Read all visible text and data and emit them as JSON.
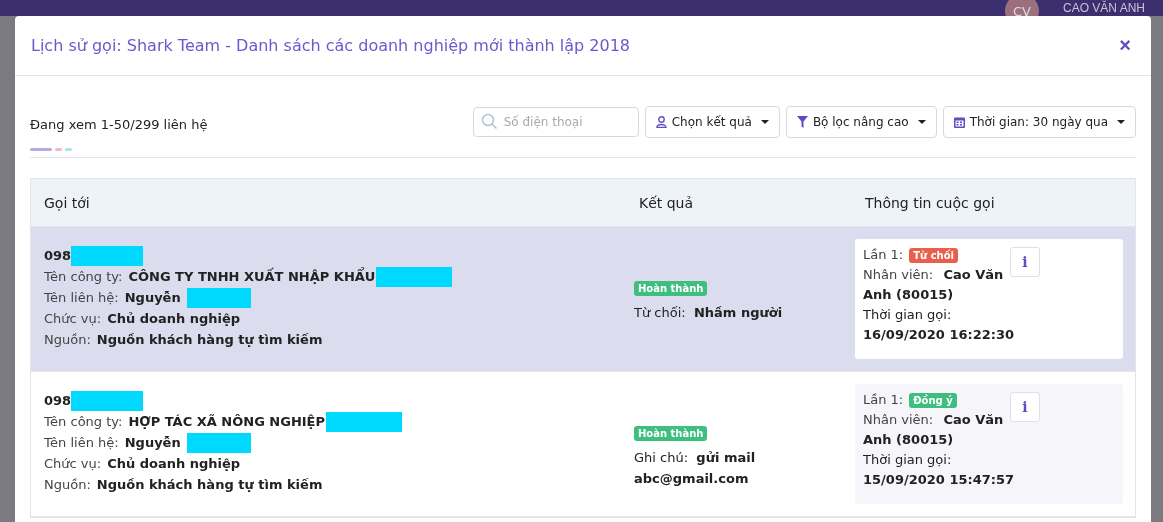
{
  "app_bar": {
    "avatar_initials": "CV",
    "user_name": "CAO VĂN ANH"
  },
  "dialog": {
    "title": "Lịch sử gọi: Shark Team - Danh sách các doanh nghiệp mới thành lập 2018",
    "close": "×"
  },
  "summary": "Đang xem 1-50/299 liên hệ",
  "search": {
    "placeholder": "Số điện thoại"
  },
  "filters": [
    {
      "label": "Chọn kết quả",
      "kind": "user"
    },
    {
      "label": "Bộ lọc nâng cao",
      "kind": "filter"
    },
    {
      "label": "Thời gian: 30 ngày qua",
      "kind": "calendar"
    }
  ],
  "table": {
    "columns": [
      "Gọi tới",
      "Kết quả",
      "Thông tin cuộc gọi"
    ],
    "rows": [
      {
        "selected": true,
        "phone": "098",
        "fields": [
          {
            "label": "Tên công ty:",
            "value": "CÔNG TY TNHH XUẤT NHẬP KHẨU"
          },
          {
            "label": "Tên liên hệ:",
            "value": "Nguyễn"
          },
          {
            "label": "Chức vụ:",
            "value": "Chủ doanh nghiệp"
          },
          {
            "label": "Nguồn:",
            "value": "Nguồn khách hàng tự tìm kiếm"
          }
        ],
        "status": "Hoàn thành",
        "result_label": "Từ chối:",
        "result_value": "Nhầm người",
        "attempt": "Lần 1:",
        "outcome": {
          "label": "Từ chối",
          "color": "#e8604c"
        },
        "staff_label": "Nhân viên:",
        "staff": "Cao Văn Anh (80015)",
        "time_label": "Thời gian gọi:",
        "time": "16/09/2020 16:22:30",
        "info": "i"
      },
      {
        "selected": false,
        "phone": "098",
        "fields": [
          {
            "label": "Tên công ty:",
            "value": "HỢP TÁC XÃ NÔNG NGHIỆP"
          },
          {
            "label": "Tên liên hệ:",
            "value": "Nguyễn"
          },
          {
            "label": "Chức vụ:",
            "value": "Chủ doanh nghiệp"
          },
          {
            "label": "Nguồn:",
            "value": "Nguồn khách hàng tự tìm kiếm"
          }
        ],
        "status": "Hoàn thành",
        "result_label": "Ghi chú:",
        "result_value": "gửi mail abc@gmail.com",
        "attempt": "Lần 1:",
        "outcome": {
          "label": "Đồng ý",
          "color": "#3fbf7f"
        },
        "staff_label": "Nhân viên:",
        "staff": "Cao Văn Anh (80015)",
        "time_label": "Thời gian gọi:",
        "time": "15/09/2020 15:47:57",
        "info": "i"
      }
    ]
  }
}
